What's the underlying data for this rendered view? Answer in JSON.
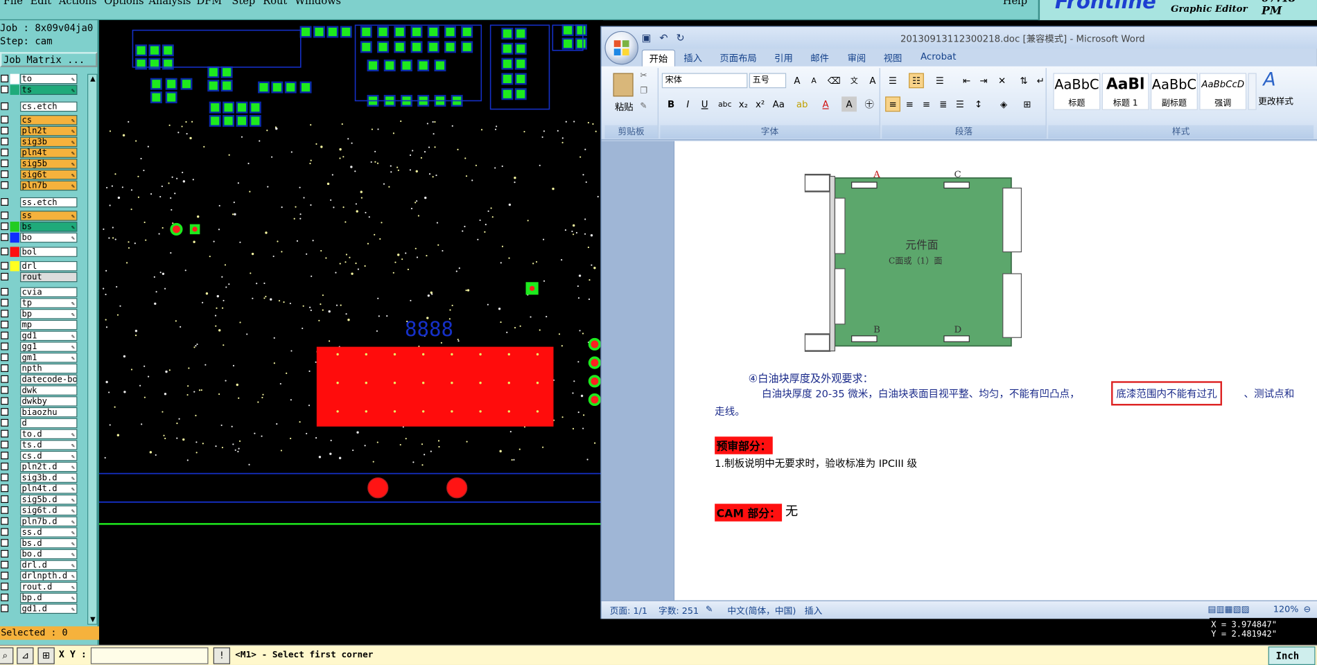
{
  "genesis": {
    "menu": {
      "file": "File",
      "edit": "Edit",
      "actions": "Actions",
      "options": "Options",
      "analysis": "Analysis",
      "dfm": "DFM",
      "step": "Step",
      "rout": "Rout",
      "windows": "Windows",
      "help": "Help"
    },
    "brand": {
      "logo": "Frontline",
      "subtitle": "Graphic Editor",
      "clock": "07:48 PM"
    },
    "job_label": "Job : 8x09v04ja0",
    "step_label": "Step: cam",
    "job_matrix_button": "Job Matrix ...",
    "layers": [
      {
        "name": "to",
        "color": "#ffffff",
        "swatch": "#ffffff",
        "edit": true
      },
      {
        "name": "ts",
        "color": "#1faa7a",
        "swatch": "#1faa7a",
        "edit": true
      },
      {
        "name": "cs.etch",
        "color": "#ffffff",
        "swatch": "",
        "edit": false
      },
      {
        "name": "cs",
        "color": "#f6b23c",
        "swatch": "",
        "edit": true
      },
      {
        "name": "pln2t",
        "color": "#f6b23c",
        "swatch": "",
        "edit": true
      },
      {
        "name": "sig3b",
        "color": "#f6b23c",
        "swatch": "",
        "edit": true
      },
      {
        "name": "pln4t",
        "color": "#f6b23c",
        "swatch": "",
        "edit": true
      },
      {
        "name": "sig5b",
        "color": "#f6b23c",
        "swatch": "",
        "edit": true
      },
      {
        "name": "sig6t",
        "color": "#f6b23c",
        "swatch": "",
        "edit": true
      },
      {
        "name": "pln7b",
        "color": "#f6b23c",
        "swatch": "",
        "edit": true
      },
      {
        "name": "ss.etch",
        "color": "#ffffff",
        "swatch": "",
        "edit": false
      },
      {
        "name": "ss",
        "color": "#f6b23c",
        "swatch": "",
        "edit": true
      },
      {
        "name": "bs",
        "color": "#1faa7a",
        "swatch": "#22cc22",
        "edit": true
      },
      {
        "name": "bo",
        "color": "#ffffff",
        "swatch": "#1030ff",
        "edit": true
      },
      {
        "name": "bol",
        "color": "#ffffff",
        "swatch": "#ff1010",
        "edit": false
      },
      {
        "name": "drl",
        "color": "#ffffff",
        "swatch": "#ffff20",
        "edit": false
      },
      {
        "name": "rout",
        "color": "#dddddd",
        "swatch": "",
        "edit": false
      },
      {
        "name": "cvia",
        "color": "#ffffff",
        "swatch": "",
        "edit": false
      },
      {
        "name": "tp",
        "color": "#ffffff",
        "swatch": "",
        "edit": true
      },
      {
        "name": "bp",
        "color": "#ffffff",
        "swatch": "",
        "edit": true
      },
      {
        "name": "mp",
        "color": "#ffffff",
        "swatch": "",
        "edit": false
      },
      {
        "name": "gd1",
        "color": "#ffffff",
        "swatch": "",
        "edit": true
      },
      {
        "name": "gg1",
        "color": "#ffffff",
        "swatch": "",
        "edit": true
      },
      {
        "name": "gm1",
        "color": "#ffffff",
        "swatch": "",
        "edit": true
      },
      {
        "name": "npth",
        "color": "#ffffff",
        "swatch": "",
        "edit": false
      },
      {
        "name": "datecode-bo",
        "color": "#ffffff",
        "swatch": "",
        "edit": false
      },
      {
        "name": "dwk",
        "color": "#ffffff",
        "swatch": "",
        "edit": false
      },
      {
        "name": "dwkby",
        "color": "#ffffff",
        "swatch": "",
        "edit": false
      },
      {
        "name": "biaozhu",
        "color": "#ffffff",
        "swatch": "",
        "edit": false
      },
      {
        "name": "d",
        "color": "#ffffff",
        "swatch": "",
        "edit": false
      },
      {
        "name": "to.d",
        "color": "#ffffff",
        "swatch": "",
        "edit": true
      },
      {
        "name": "ts.d",
        "color": "#ffffff",
        "swatch": "",
        "edit": true
      },
      {
        "name": "cs.d",
        "color": "#ffffff",
        "swatch": "",
        "edit": true
      },
      {
        "name": "pln2t.d",
        "color": "#ffffff",
        "swatch": "",
        "edit": true
      },
      {
        "name": "sig3b.d",
        "color": "#ffffff",
        "swatch": "",
        "edit": true
      },
      {
        "name": "pln4t.d",
        "color": "#ffffff",
        "swatch": "",
        "edit": true
      },
      {
        "name": "sig5b.d",
        "color": "#ffffff",
        "swatch": "",
        "edit": true
      },
      {
        "name": "sig6t.d",
        "color": "#ffffff",
        "swatch": "",
        "edit": true
      },
      {
        "name": "pln7b.d",
        "color": "#ffffff",
        "swatch": "",
        "edit": true
      },
      {
        "name": "ss.d",
        "color": "#ffffff",
        "swatch": "",
        "edit": true
      },
      {
        "name": "bs.d",
        "color": "#ffffff",
        "swatch": "",
        "edit": true
      },
      {
        "name": "bo.d",
        "color": "#ffffff",
        "swatch": "",
        "edit": true
      },
      {
        "name": "drl.d",
        "color": "#ffffff",
        "swatch": "",
        "edit": true
      },
      {
        "name": "drlnpth.d",
        "color": "#ffffff",
        "swatch": "",
        "edit": true
      },
      {
        "name": "rout.d",
        "color": "#ffffff",
        "swatch": "",
        "edit": true
      },
      {
        "name": "bp.d",
        "color": "#ffffff",
        "swatch": "",
        "edit": true
      },
      {
        "name": "gd1.d",
        "color": "#ffffff",
        "swatch": "",
        "edit": true
      }
    ],
    "selected": "Selected : 0",
    "xy_label": "X Y :",
    "xy_value": "",
    "prompt": "<M1> - Select first corner",
    "unit": "Inch",
    "coord_x": "X = 3.974847\"",
    "coord_y": "Y = 2.481942\"",
    "canvas_text": {
      "silk_8888": "8888"
    }
  },
  "word": {
    "title": "20130913112300218.doc [兼容模式] - Microsoft Word",
    "tabs": [
      "开始",
      "插入",
      "页面布局",
      "引用",
      "邮件",
      "审阅",
      "视图",
      "Acrobat"
    ],
    "ribbon": {
      "clipboard_label": "剪贴板",
      "paste_label": "粘贴",
      "font_label": "字体",
      "paragraph_label": "段落",
      "styles_label": "样式",
      "font_name": "宋体",
      "font_size": "五号",
      "styles": [
        {
          "preview": "AaBbC",
          "label": "标题"
        },
        {
          "preview": "AaBl",
          "label": "标题 1"
        },
        {
          "preview": "AaBbC",
          "label": "副标题"
        },
        {
          "preview": "AaBbCcD",
          "label": "强调"
        }
      ],
      "change_styles": "更改样式"
    },
    "doc": {
      "figure_labels": {
        "a": "A",
        "b": "B",
        "c": "C",
        "d": "D",
        "face": "元件面",
        "face_sub": "C面或（1）面"
      },
      "heading4": "④白油块厚度及外观要求：",
      "para_main": "白油块厚度 20-35 微米，白油块表面目视平整、均匀，不能有凹凸点，",
      "para_highlight": "底漆范围内不能有过孔",
      "para_tail": "、测试点和",
      "para_wrap": "走线。",
      "section_review": "预审部分：",
      "review_item": "1.制板说明中无要求时，验收标准为 IPCIII 级",
      "section_cam": "CAM 部分：",
      "cam_value": "无"
    },
    "status": {
      "page": "页面: 1/1",
      "words": "字数: 251",
      "language": "中文(简体，中国)",
      "mode": "插入",
      "zoom": "120%"
    }
  }
}
